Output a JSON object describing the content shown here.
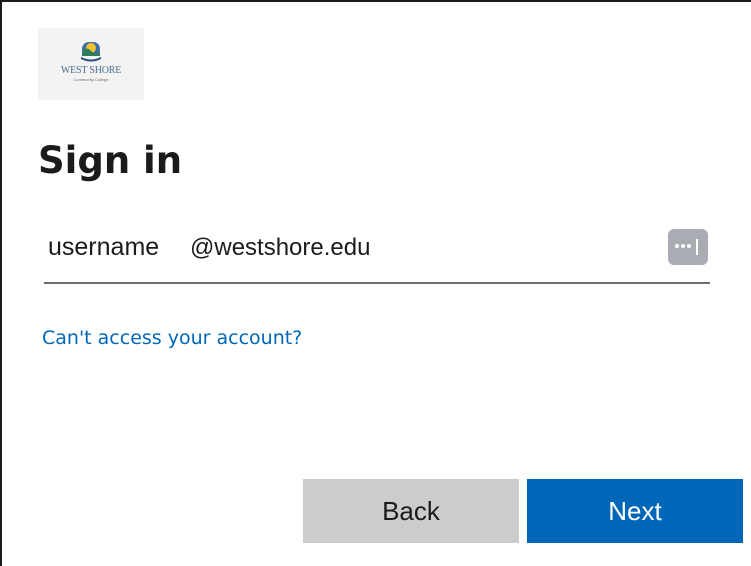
{
  "logo": {
    "line1": "WEST SHORE",
    "line2": "Community College"
  },
  "title": "Sign in",
  "email": {
    "username": "username",
    "domain": "@westshore.edu"
  },
  "icons": {
    "credential": "password-dots-icon"
  },
  "link": {
    "cant_access": "Can't access your account?"
  },
  "buttons": {
    "back": "Back",
    "next": "Next"
  },
  "colors": {
    "accent": "#0067b8",
    "back_button": "#cccccc",
    "credential_icon": "#a9adb3",
    "logo_text": "#4a6d8c"
  }
}
